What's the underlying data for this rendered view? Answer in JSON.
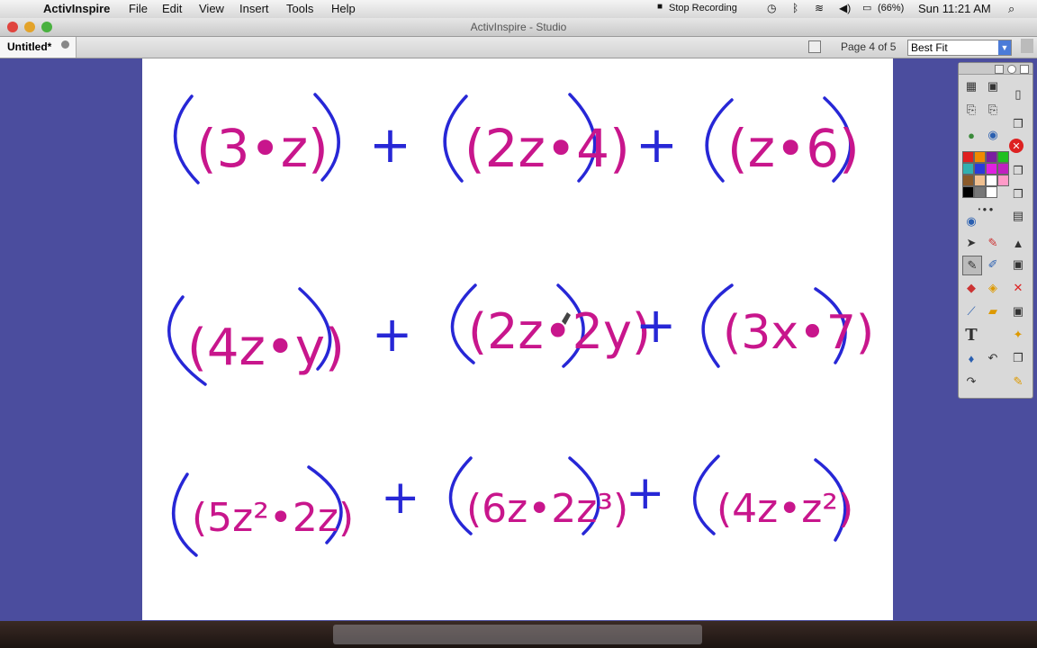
{
  "menubar": {
    "app_name": "ActivInspire",
    "items": [
      "File",
      "Edit",
      "View",
      "Insert",
      "Tools",
      "Help"
    ],
    "stop_recording": "Stop Recording",
    "battery": "(66%)",
    "clock": "Sun 11:21 AM"
  },
  "window": {
    "title": "ActivInspire - Studio"
  },
  "tabs": {
    "doc_tab": "Untitled*",
    "page_indicator": "Page 4 of 5",
    "zoom_value": "Best Fit"
  },
  "expressions": {
    "row1": [
      "(3•z)",
      "+",
      "(2z•4)",
      "+",
      "(z•6)"
    ],
    "row2": [
      "(4z•y)",
      "+",
      "(2z•2y)",
      "+",
      "(3x•7)"
    ],
    "row3": [
      "(5z²•2z)",
      "+",
      "(6z•2z³)",
      "+",
      "(4z•z²)"
    ]
  },
  "text_tool": "T",
  "colors": {
    "ink_blue": "#2727d6",
    "ink_magenta": "#c8168c",
    "panel": "#4b4d9e"
  }
}
